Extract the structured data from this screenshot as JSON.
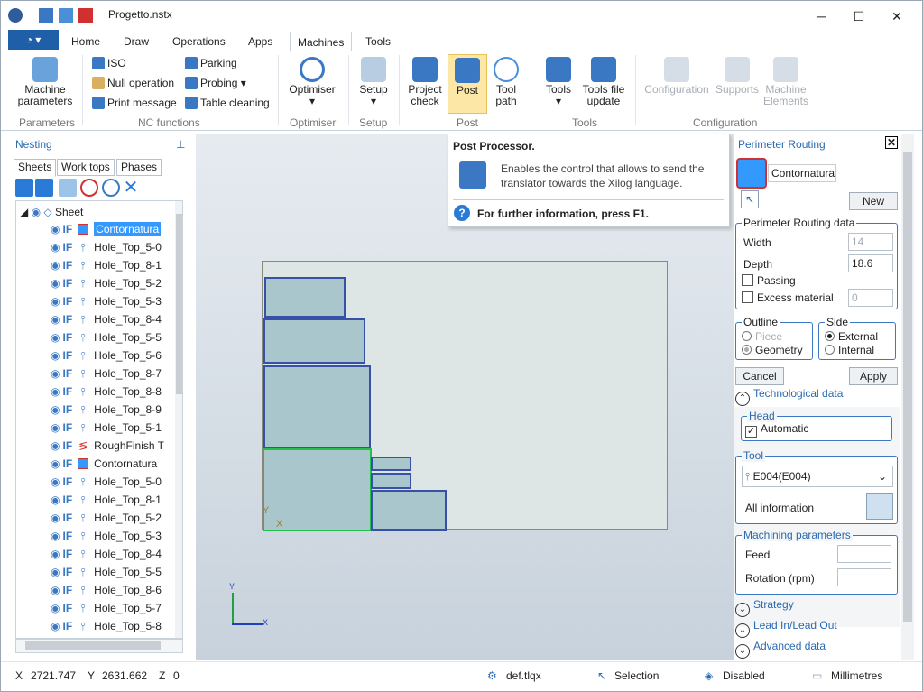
{
  "window": {
    "title": "Progetto.nstx",
    "minimize": "─",
    "maximize": "☐",
    "close": "✕"
  },
  "tabs": [
    "Home",
    "Draw",
    "Operations",
    "Apps",
    "Machines",
    "Tools"
  ],
  "ribbon": {
    "parameters": {
      "button": "Machine parameters",
      "group": "Parameters"
    },
    "nc": {
      "iso": "ISO",
      "null_op": "Null operation",
      "print_msg": "Print message",
      "parking": "Parking",
      "probing": "Probing",
      "table_cleaning": "Table cleaning",
      "group": "NC functions"
    },
    "optimiser": {
      "button": "Optimiser",
      "group": "Optimiser"
    },
    "setup": {
      "button": "Setup",
      "group": "Setup"
    },
    "post": {
      "project_check": "Project check",
      "post": "Post",
      "tool_path": "Tool path",
      "group": "Post"
    },
    "tools": {
      "tools": "Tools",
      "tools_file_update": "Tools file update",
      "group": "Tools"
    },
    "configuration": {
      "configuration": "Configuration",
      "supports": "Supports",
      "machine_elements": "Machine Elements",
      "group": "Configuration"
    }
  },
  "tooltip": {
    "title": "Post Processor.",
    "body": "Enables the control that allows to send the translator towards the Xilog language.",
    "help": "For further information, press F1."
  },
  "left_pane": {
    "title": "Nesting",
    "tabs": [
      "Sheets",
      "Work tops",
      "Phases"
    ],
    "root": "Sheet",
    "rows": [
      {
        "label": "Contornatura",
        "kind": "contour",
        "selected": true
      },
      {
        "label": "Hole_Top_5-0",
        "kind": "hole"
      },
      {
        "label": "Hole_Top_8-1",
        "kind": "hole"
      },
      {
        "label": "Hole_Top_5-2",
        "kind": "hole"
      },
      {
        "label": "Hole_Top_5-3",
        "kind": "hole"
      },
      {
        "label": "Hole_Top_8-4",
        "kind": "hole"
      },
      {
        "label": "Hole_Top_5-5",
        "kind": "hole"
      },
      {
        "label": "Hole_Top_5-6",
        "kind": "hole"
      },
      {
        "label": "Hole_Top_8-7",
        "kind": "hole"
      },
      {
        "label": "Hole_Top_8-8",
        "kind": "hole"
      },
      {
        "label": "Hole_Top_8-9",
        "kind": "hole"
      },
      {
        "label": "Hole_Top_5-1",
        "kind": "hole"
      },
      {
        "label": "RoughFinish T",
        "kind": "rough"
      },
      {
        "label": "Contornatura",
        "kind": "contour"
      },
      {
        "label": "Hole_Top_5-0",
        "kind": "hole"
      },
      {
        "label": "Hole_Top_8-1",
        "kind": "hole"
      },
      {
        "label": "Hole_Top_5-2",
        "kind": "hole"
      },
      {
        "label": "Hole_Top_5-3",
        "kind": "hole"
      },
      {
        "label": "Hole_Top_8-4",
        "kind": "hole"
      },
      {
        "label": "Hole_Top_5-5",
        "kind": "hole"
      },
      {
        "label": "Hole_Top_8-6",
        "kind": "hole"
      },
      {
        "label": "Hole_Top_5-7",
        "kind": "hole"
      },
      {
        "label": "Hole_Top_5-8",
        "kind": "hole"
      }
    ],
    "if_label": "IF"
  },
  "canvas": {
    "axis_x": "X",
    "axis_y": "Y",
    "sheet_x": "X",
    "sheet_y": "Y"
  },
  "right_pane": {
    "title": "Perimeter Routing",
    "op_name": "Contornatura",
    "new_btn": "New",
    "data_group": "Perimeter Routing data",
    "width_label": "Width",
    "width_value": "14",
    "depth_label": "Depth",
    "depth_value": "18.6",
    "passing_label": "Passing",
    "excess_label": "Excess material",
    "excess_value": "0",
    "outline": {
      "title": "Outline",
      "piece": "Piece",
      "geometry": "Geometry"
    },
    "side": {
      "title": "Side",
      "external": "External",
      "internal": "Internal"
    },
    "cancel_btn": "Cancel",
    "apply_btn": "Apply",
    "tech_data": "Technological data",
    "head": {
      "title": "Head",
      "automatic": "Automatic"
    },
    "tool": {
      "title": "Tool",
      "value": "E004(E004)",
      "all_info": "All information"
    },
    "machining": {
      "title": "Machining parameters",
      "feed": "Feed",
      "rotation": "Rotation (rpm)"
    },
    "strategy": "Strategy",
    "lead": "Lead In/Lead Out",
    "advanced": "Advanced data"
  },
  "status": {
    "x_label": "X",
    "x_value": "2721.747",
    "y_label": "Y",
    "y_value": "2631.662",
    "z_label": "Z",
    "z_value": "0",
    "file": "def.tlqx",
    "mode": "Selection",
    "snap": "Disabled",
    "units": "Millimetres"
  },
  "colors": {
    "accent": "#1f5fa8",
    "link": "#2a6ab0",
    "selection": "#3399ff"
  }
}
